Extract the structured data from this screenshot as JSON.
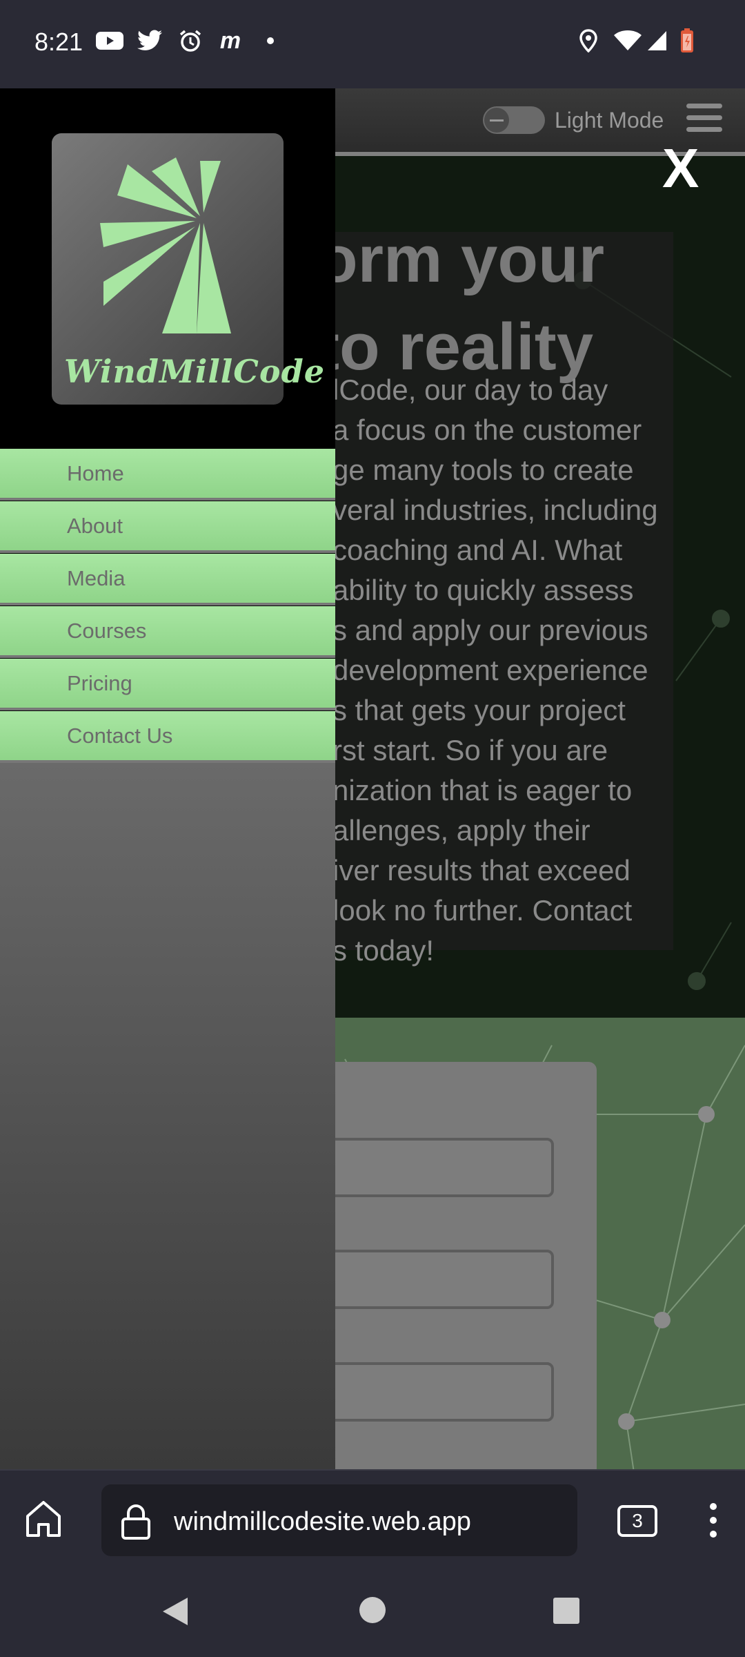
{
  "status_bar": {
    "time": "8:21",
    "left_icons": [
      "youtube-icon",
      "twitter-icon",
      "alarm-icon",
      "m-app-icon",
      "dot-icon"
    ],
    "right_icons": [
      "location-icon",
      "wifi-icon",
      "signal-icon",
      "battery-icon"
    ]
  },
  "header": {
    "mode_label": "Light Mode"
  },
  "hero": {
    "title_line1": "orm your",
    "title_line2": "to reality",
    "paragraph_lines": [
      "lCode, our day to day",
      "a focus on the customer",
      "ge many tools to create",
      "veral industries, including",
      " coaching and AI. What",
      " ability to quickly assess",
      "s and apply our previous",
      "development experience",
      "s that gets your project",
      "rst start. So if you are",
      "nization that is eager to",
      "allenges, apply their",
      "iver results that exceed",
      "look no further. Contact",
      "s today!"
    ]
  },
  "drawer": {
    "logo_text": "WindMillCode",
    "close_label": "X",
    "nav_items": [
      "Home",
      "About",
      "Media",
      "Courses",
      "Pricing",
      "Contact Us"
    ]
  },
  "browser": {
    "url": "windmillcodesite.web.app",
    "tab_count": "3"
  },
  "colors": {
    "accent_green": "#a8e6a2",
    "drawer_bg": "#000000",
    "system_bar": "#2a2a35"
  }
}
